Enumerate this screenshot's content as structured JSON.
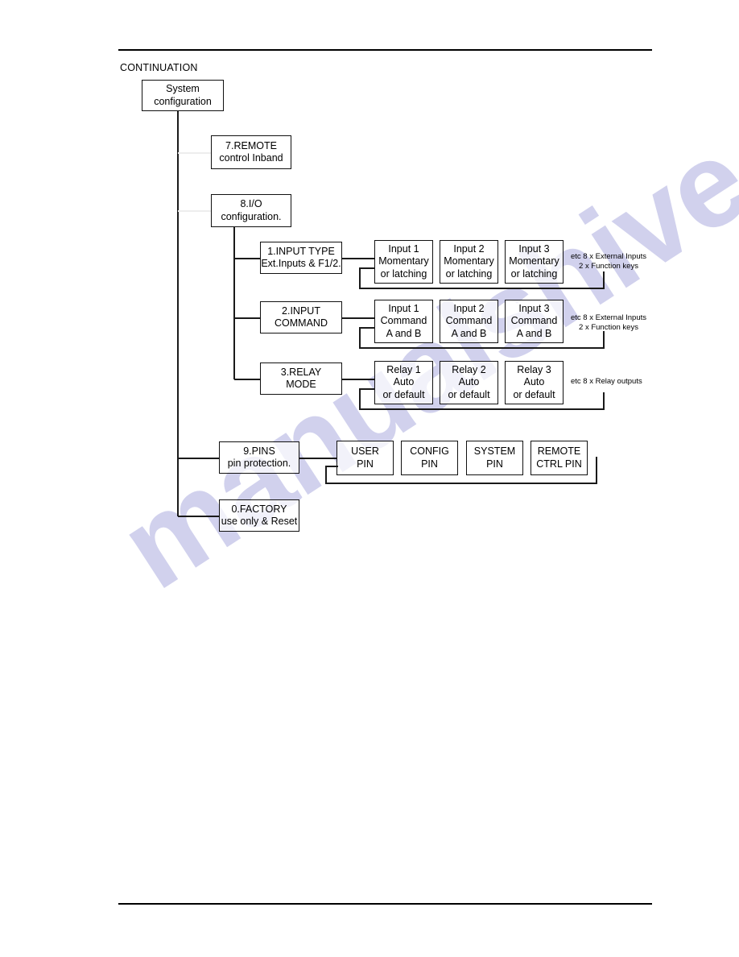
{
  "page": {
    "heading": "CONTINUATION",
    "watermark_text": "manualshive.com"
  },
  "diagram": {
    "type": "tree",
    "root": {
      "line1": "System",
      "line2": "configuration"
    },
    "branches": [
      {
        "id": "remote",
        "line1": "7.REMOTE",
        "line2": "control Inband"
      },
      {
        "id": "io",
        "line1": "8.I/O",
        "line2": "configuration."
      },
      {
        "id": "pins",
        "line1": "9.PINS",
        "line2": "pin protection."
      },
      {
        "id": "factory",
        "line1": "0.FACTORY",
        "line2": "use only & Reset"
      }
    ],
    "io_submenus": [
      {
        "id": "input-type",
        "line1": "1.INPUT TYPE",
        "line2": "Ext.Inputs & F1/2.",
        "note_line1": "etc 8 x External Inputs",
        "note_line2": "2 x Function keys",
        "items": [
          {
            "line1": "Input 1",
            "line2": "Momentary",
            "line3": "or latching"
          },
          {
            "line1": "Input 2",
            "line2": "Momentary",
            "line3": "or latching"
          },
          {
            "line1": "Input 3",
            "line2": "Momentary",
            "line3": "or latching"
          }
        ]
      },
      {
        "id": "input-command",
        "line1": "2.INPUT",
        "line2": "COMMAND",
        "note_line1": "etc 8 x External Inputs",
        "note_line2": "2 x Function keys",
        "items": [
          {
            "line1": "Input 1",
            "line2": "Command",
            "line3": "A and B"
          },
          {
            "line1": "Input 2",
            "line2": "Command",
            "line3": "A and B"
          },
          {
            "line1": "Input 3",
            "line2": "Command",
            "line3": "A and B"
          }
        ]
      },
      {
        "id": "relay-mode",
        "line1": "3.RELAY",
        "line2": "MODE",
        "note_line1": "etc 8 x Relay outputs",
        "note_line2": "",
        "items": [
          {
            "line1": "Relay 1",
            "line2": "Auto",
            "line3": "or default"
          },
          {
            "line1": "Relay 2",
            "line2": "Auto",
            "line3": "or default"
          },
          {
            "line1": "Relay 3",
            "line2": "Auto",
            "line3": "or default"
          }
        ]
      }
    ],
    "pin_items": [
      {
        "line1": "USER",
        "line2": "PIN"
      },
      {
        "line1": "CONFIG",
        "line2": "PIN"
      },
      {
        "line1": "SYSTEM",
        "line2": "PIN"
      },
      {
        "line1": "REMOTE",
        "line2": "CTRL PIN"
      }
    ]
  }
}
